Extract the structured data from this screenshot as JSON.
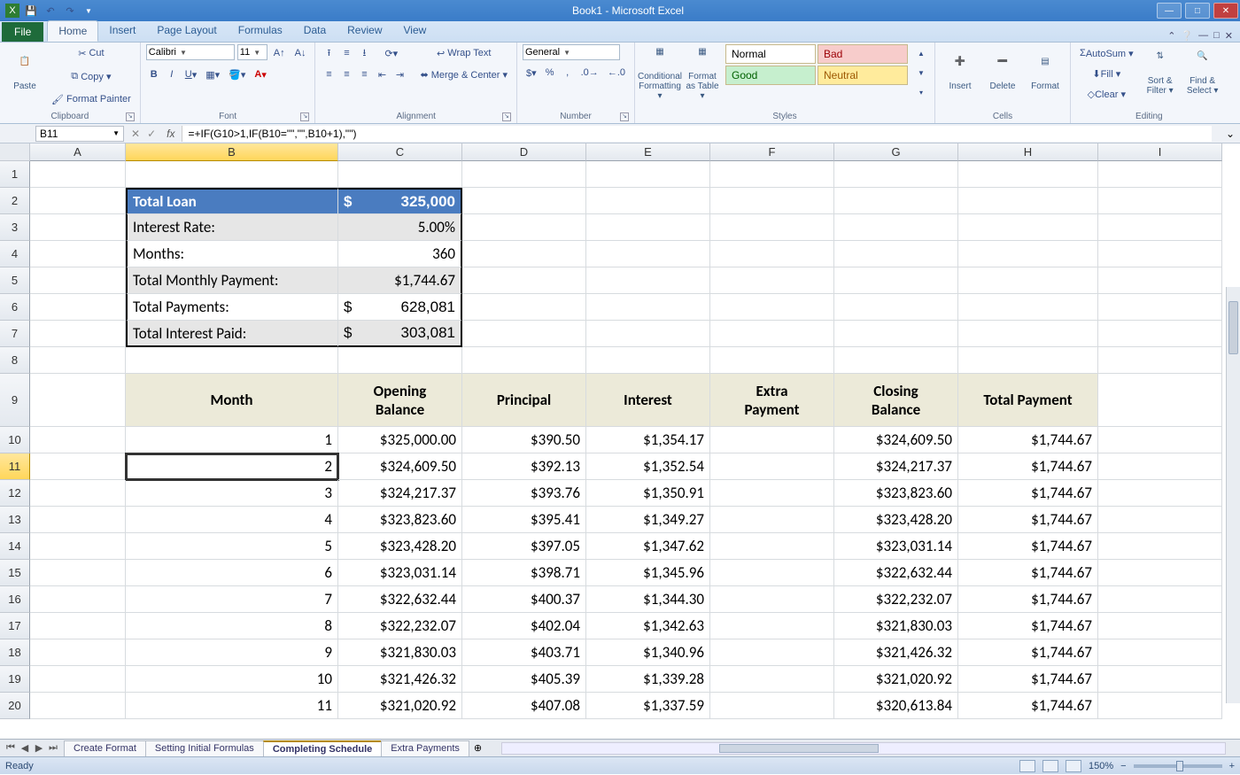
{
  "window_title": "Book1 - Microsoft Excel",
  "tabs": {
    "file": "File",
    "list": [
      "Home",
      "Insert",
      "Page Layout",
      "Formulas",
      "Data",
      "Review",
      "View"
    ],
    "active": "Home"
  },
  "clipboard": {
    "paste": "Paste",
    "cut": "Cut",
    "copy": "Copy ▾",
    "fmtpainter": "Format Painter",
    "label": "Clipboard"
  },
  "font": {
    "name": "Calibri",
    "size": "11",
    "label": "Font"
  },
  "alignment": {
    "wrap": "Wrap Text",
    "merge": "Merge & Center ▾",
    "label": "Alignment"
  },
  "number": {
    "format": "General",
    "label": "Number"
  },
  "styles": {
    "cond": "Conditional Formatting ▾",
    "fat": "Format as Table ▾",
    "normal": "Normal",
    "bad": "Bad",
    "good": "Good",
    "neutral": "Neutral",
    "label": "Styles"
  },
  "cells": {
    "insert": "Insert",
    "delete": "Delete",
    "format": "Format",
    "label": "Cells"
  },
  "editing": {
    "autosum": "AutoSum ▾",
    "fill": "Fill ▾",
    "clear": "Clear ▾",
    "sort": "Sort & Filter ▾",
    "find": "Find & Select ▾",
    "label": "Editing"
  },
  "namebox": "B11",
  "formula": "=+IF(G10>1,IF(B10=\"\",\"\",B10+1),\"\")",
  "columns": [
    "A",
    "B",
    "C",
    "D",
    "E",
    "F",
    "G",
    "H",
    "I"
  ],
  "rows_visible": 20,
  "active_col": "B",
  "active_row": 11,
  "loan": {
    "r2b": "Total Loan",
    "r2c_sym": "$",
    "r2c": "325,000",
    "r3b": "Interest Rate:",
    "r3c": "5.00%",
    "r4b": "Months:",
    "r4c": "360",
    "r5b": "Total Monthly  Payment:",
    "r5c": "$1,744.67",
    "r6b": "Total Payments:",
    "r6c_sym": "$",
    "r6c": "628,081",
    "r7b": "Total Interest Paid:",
    "r7c_sym": "$",
    "r7c": "303,081"
  },
  "sched_headers": {
    "B": "Month",
    "C1": "Opening",
    "C2": "Balance",
    "D": "Principal",
    "E": "Interest",
    "F1": "Extra",
    "F2": "Payment",
    "G1": "Closing",
    "G2": "Balance",
    "H": "Total Payment"
  },
  "schedule": [
    {
      "m": "1",
      "ob": "$325,000.00",
      "p": "$390.50",
      "i": "$1,354.17",
      "ep": "",
      "cb": "$324,609.50",
      "tp": "$1,744.67"
    },
    {
      "m": "2",
      "ob": "$324,609.50",
      "p": "$392.13",
      "i": "$1,352.54",
      "ep": "",
      "cb": "$324,217.37",
      "tp": "$1,744.67"
    },
    {
      "m": "3",
      "ob": "$324,217.37",
      "p": "$393.76",
      "i": "$1,350.91",
      "ep": "",
      "cb": "$323,823.60",
      "tp": "$1,744.67"
    },
    {
      "m": "4",
      "ob": "$323,823.60",
      "p": "$395.41",
      "i": "$1,349.27",
      "ep": "",
      "cb": "$323,428.20",
      "tp": "$1,744.67"
    },
    {
      "m": "5",
      "ob": "$323,428.20",
      "p": "$397.05",
      "i": "$1,347.62",
      "ep": "",
      "cb": "$323,031.14",
      "tp": "$1,744.67"
    },
    {
      "m": "6",
      "ob": "$323,031.14",
      "p": "$398.71",
      "i": "$1,345.96",
      "ep": "",
      "cb": "$322,632.44",
      "tp": "$1,744.67"
    },
    {
      "m": "7",
      "ob": "$322,632.44",
      "p": "$400.37",
      "i": "$1,344.30",
      "ep": "",
      "cb": "$322,232.07",
      "tp": "$1,744.67"
    },
    {
      "m": "8",
      "ob": "$322,232.07",
      "p": "$402.04",
      "i": "$1,342.63",
      "ep": "",
      "cb": "$321,830.03",
      "tp": "$1,744.67"
    },
    {
      "m": "9",
      "ob": "$321,830.03",
      "p": "$403.71",
      "i": "$1,340.96",
      "ep": "",
      "cb": "$321,426.32",
      "tp": "$1,744.67"
    },
    {
      "m": "10",
      "ob": "$321,426.32",
      "p": "$405.39",
      "i": "$1,339.28",
      "ep": "",
      "cb": "$321,020.92",
      "tp": "$1,744.67"
    },
    {
      "m": "11",
      "ob": "$321,020.92",
      "p": "$407.08",
      "i": "$1,337.59",
      "ep": "",
      "cb": "$320,613.84",
      "tp": "$1,744.67"
    }
  ],
  "sheets": [
    "Create Format",
    "Setting Initial Formulas",
    "Completing Schedule",
    "Extra Payments"
  ],
  "active_sheet": "Completing Schedule",
  "status": "Ready",
  "zoom": "150%"
}
